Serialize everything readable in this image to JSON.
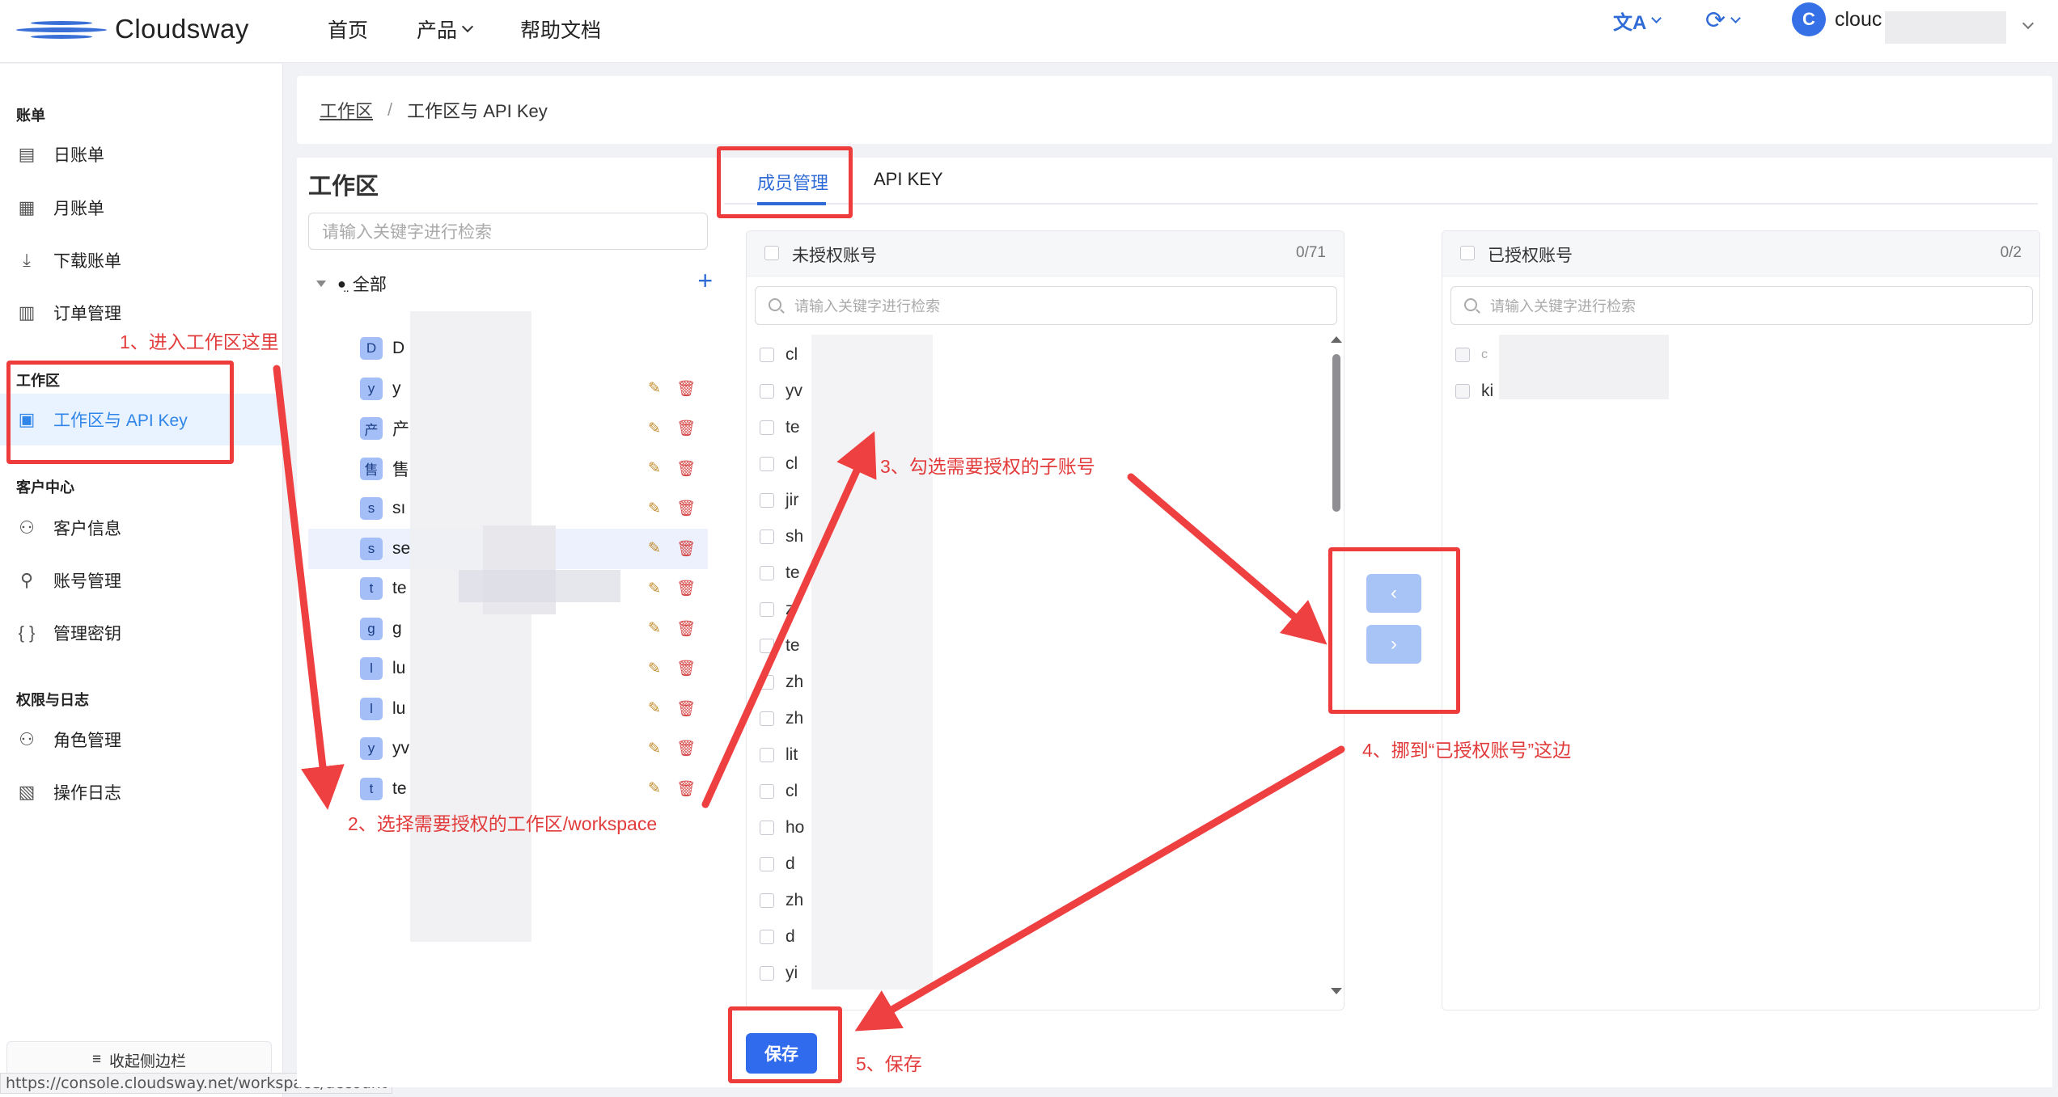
{
  "header": {
    "brand": "Cloudsway",
    "nav": [
      {
        "label": "首页"
      },
      {
        "label": "产品"
      },
      {
        "label": "帮助文档"
      }
    ],
    "translate_icon": "文A",
    "sync_icon": "⟳",
    "user_initial": "C",
    "user_name": "clouc"
  },
  "sidebar": {
    "group_billing": "账单",
    "item_daily": "日账单",
    "item_monthly": "月账单",
    "item_download": "下载账单",
    "item_orders": "订单管理",
    "group_workspace": "工作区",
    "item_workspace_api": "工作区与 API Key",
    "group_customer": "客户中心",
    "item_customer_info": "客户信息",
    "item_account_mgmt": "账号管理",
    "item_keys": "管理密钥",
    "group_perm": "权限与日志",
    "item_roles": "角色管理",
    "item_logs": "操作日志",
    "collapse": "收起侧边栏"
  },
  "status_url": "https://console.cloudsway.net/workspace/account",
  "breadcrumb": {
    "root": "工作区",
    "sep": "/",
    "current": "工作区与 API Key"
  },
  "workspace_panel": {
    "title": "工作区",
    "search_placeholder": "请输入关键字进行检索",
    "root_label": "全部",
    "items": [
      {
        "badge": "D",
        "name": "D"
      },
      {
        "badge": "y",
        "name": "y"
      },
      {
        "badge": "产",
        "name": "产"
      },
      {
        "badge": "售",
        "name": "售"
      },
      {
        "badge": "s",
        "name": "sı"
      },
      {
        "badge": "s",
        "name": "se"
      },
      {
        "badge": "t",
        "name": "te"
      },
      {
        "badge": "g",
        "name": "g"
      },
      {
        "badge": "l",
        "name": "lu"
      },
      {
        "badge": "l",
        "name": "lu"
      },
      {
        "badge": "y",
        "name": "yv"
      },
      {
        "badge": "t",
        "name": "te"
      }
    ]
  },
  "tabs": {
    "members": "成员管理",
    "api_key": "API KEY"
  },
  "unauthorized": {
    "title": "未授权账号",
    "count": "0/71",
    "search_placeholder": "请输入关键字进行检索",
    "accounts": [
      "cl",
      "yv",
      "te",
      "cl",
      "jir",
      "sh",
      "te",
      "z",
      "te",
      "zh",
      "zh",
      "lit",
      "cl",
      "ho",
      "d",
      "zh",
      "d",
      "yi"
    ]
  },
  "authorized": {
    "title": "已授权账号",
    "count": "0/2",
    "search_placeholder": "请输入关键字进行检索",
    "accounts": [
      "c",
      "ki"
    ]
  },
  "transfer": {
    "left_arrow": "‹",
    "right_arrow": "›"
  },
  "save_button": "保存",
  "annotations": {
    "step1": "1、进入工作区这里",
    "step2": "2、选择需要授权的工作区/workspace",
    "step3": "3、勾选需要授权的子账号",
    "step4": "4、挪到“已授权账号”这边",
    "step5": "5、保存"
  },
  "colors": {
    "primary": "#2f6bd6",
    "annotation": "#ee3b3b",
    "active_bg": "#e9f2ff"
  }
}
